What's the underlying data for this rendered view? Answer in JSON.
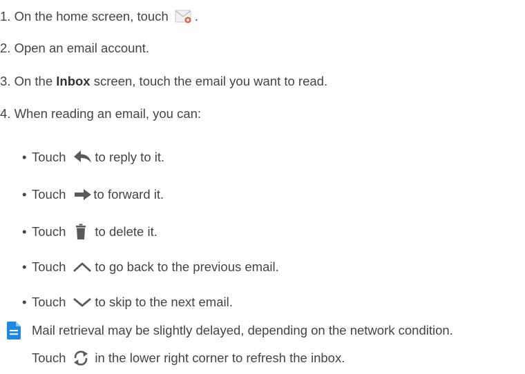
{
  "steps": [
    {
      "number": "1.",
      "before": "On the home screen, touch",
      "after": "."
    },
    {
      "number": "2.",
      "text": "Open an email account."
    },
    {
      "number": "3.",
      "before": "On the",
      "bold": "Inbox",
      "after": "screen, touch the email you want to read."
    },
    {
      "number": "4.",
      "text": "When reading an email, you can:"
    }
  ],
  "bullets": [
    {
      "mark": "•",
      "lead": "Touch",
      "icon": "reply-arrow-icon",
      "rest": "to reply to it."
    },
    {
      "mark": "•",
      "lead": "Touch",
      "icon": "forward-arrow-icon",
      "rest": "to forward it."
    },
    {
      "mark": "•",
      "lead": "Touch",
      "icon": "trash-icon",
      "rest": "to delete it."
    },
    {
      "mark": "•",
      "lead": "Touch",
      "icon": "chevron-up-icon",
      "rest": "to go back to the previous email."
    },
    {
      "mark": "•",
      "lead": "Touch",
      "icon": "chevron-down-icon",
      "rest": "to skip to the next email."
    }
  ],
  "note": {
    "icon": "note-document-icon",
    "line1": "Mail retrieval may be slightly delayed, depending on the network condition.",
    "line2_lead": "Touch",
    "line2_icon": "refresh-icon",
    "line2_rest": "in the lower right corner to refresh the inbox."
  },
  "colors": {
    "text": "#444444",
    "icon": "#5a5a5a",
    "note_icon": "#1e88e5",
    "email_icon_accent": "#e0603a"
  }
}
